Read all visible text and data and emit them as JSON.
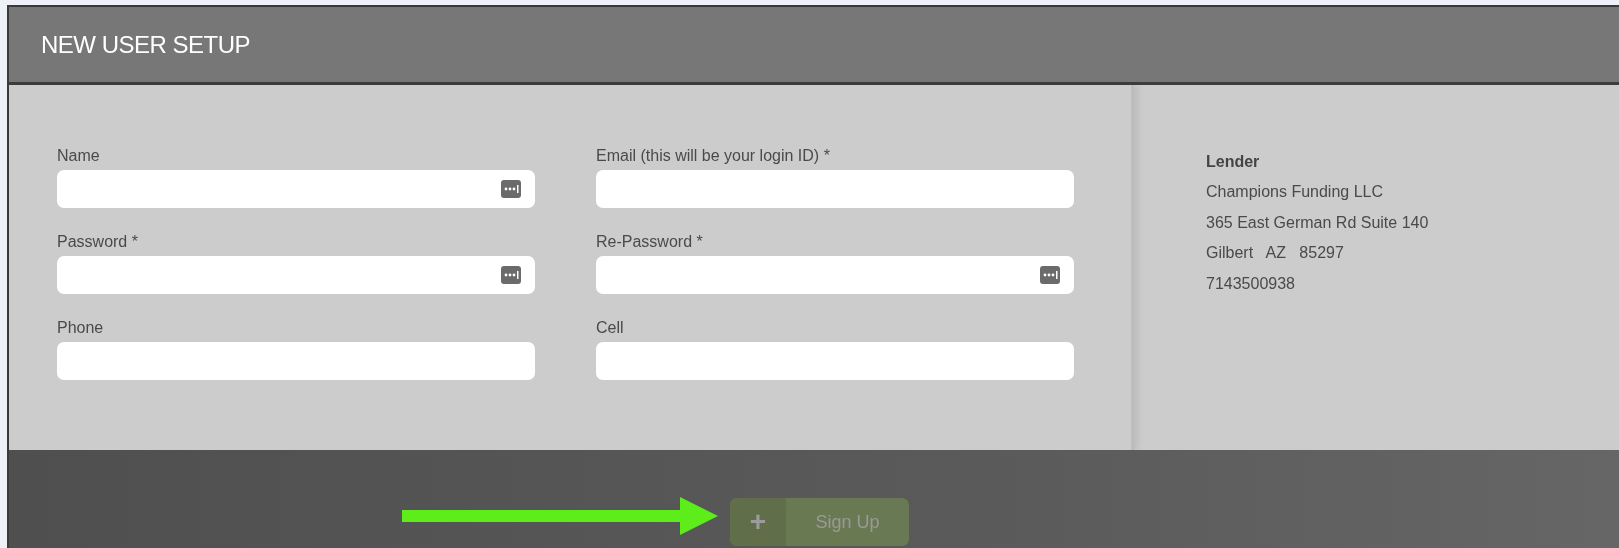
{
  "window": {
    "title": "NEW USER SETUP"
  },
  "fields": [
    {
      "label": "Name",
      "has_icon": true
    },
    {
      "label": "Email (this will be your login ID) *",
      "has_icon": false
    },
    {
      "label": "Password *",
      "has_icon": true
    },
    {
      "label": "Re-Password *",
      "has_icon": true
    },
    {
      "label": "Phone",
      "has_icon": false
    },
    {
      "label": "Cell",
      "has_icon": false
    }
  ],
  "lender": {
    "heading": "Lender",
    "lines": [
      "Champions Funding LLC",
      "365 East German Rd Suite 140",
      "Gilbert   AZ   85297",
      "7143500938"
    ]
  },
  "sign_up_button": {
    "icon": "+",
    "label": "Sign Up",
    "disabled": true
  }
}
